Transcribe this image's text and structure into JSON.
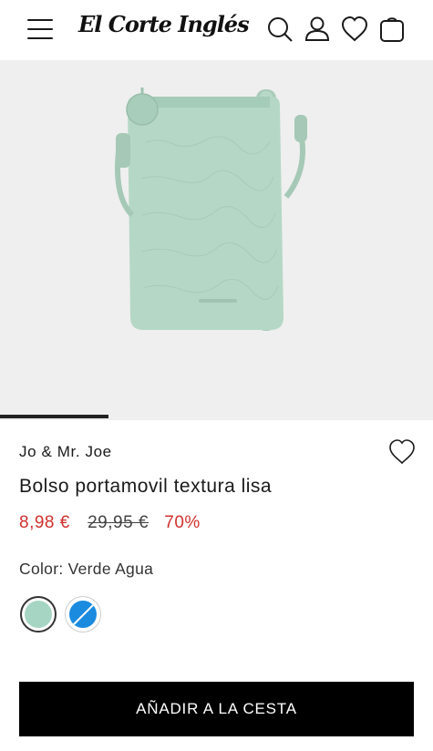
{
  "header": {
    "logo": "El Corte Inglés",
    "icons": [
      "menu-icon",
      "search-icon",
      "user-icon",
      "heart-icon",
      "shopping-bag-icon"
    ]
  },
  "gallery": {
    "progress_fraction": 0.25,
    "background": "#efefef"
  },
  "product": {
    "brand": "Jo & Mr. Joe",
    "title": "Bolso portamovil textura lisa",
    "price_now": "8,98 €",
    "price_old": "29,95 €",
    "discount": "70%",
    "color_label": "Color: Verde Agua",
    "swatches": [
      {
        "name": "Verde Agua",
        "color": "#a6d5c3",
        "selected": true
      },
      {
        "name": "Azul",
        "color": "#1b8be0",
        "selected": false,
        "unavailable": true
      }
    ]
  },
  "cta": {
    "label": "AÑADIR A LA CESTA"
  },
  "colors": {
    "sale_red": "#d0312d",
    "bag_green": "#b5d8c6"
  }
}
